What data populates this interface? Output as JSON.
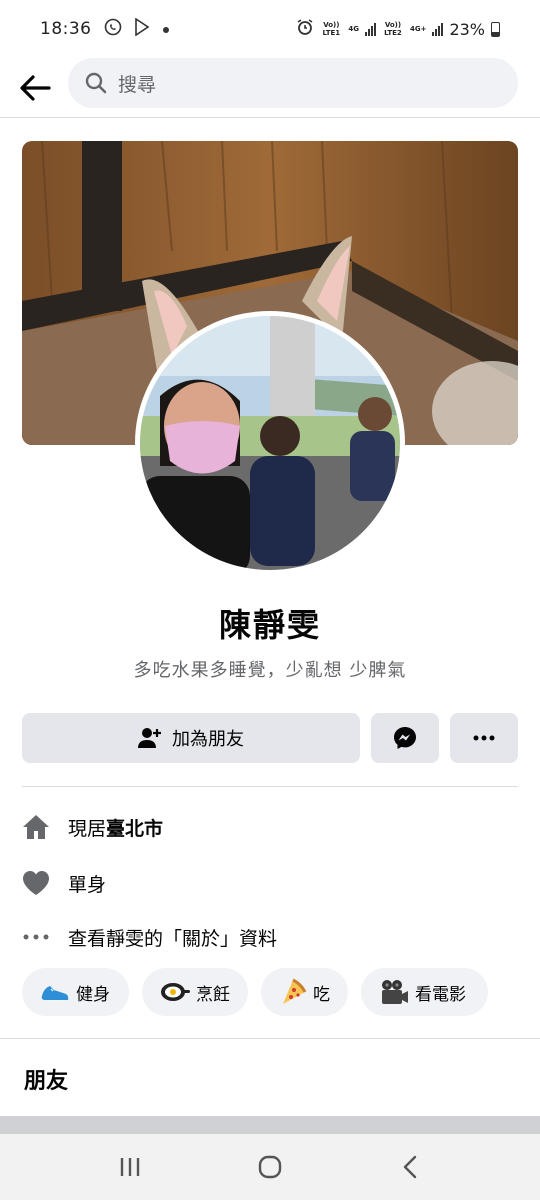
{
  "status_bar": {
    "time": "18:36",
    "sim1_label": "Vo)) LTE1",
    "sim1_net": "4G",
    "sim2_label": "Vo)) LTE2",
    "sim2_net": "4G+",
    "battery": "23%",
    "icons": [
      "whatsapp-icon",
      "play-store-icon",
      "dot-icon",
      "alarm-icon",
      "signal-icon",
      "battery-icon"
    ]
  },
  "search": {
    "placeholder": "搜尋"
  },
  "profile": {
    "name": "陳靜雯",
    "bio": "多吃水果多睡覺，少亂想 少脾氣"
  },
  "actions": {
    "add_friend_label": "加為朋友"
  },
  "intro": {
    "location_prefix": "現居",
    "location_city": "臺北市",
    "relationship": "單身",
    "about_link": "查看靜雯的「關於」資料"
  },
  "hobbies": [
    {
      "label": "健身",
      "icon": "sneaker-icon"
    },
    {
      "label": "烹飪",
      "icon": "frying-pan-icon"
    },
    {
      "label": "吃",
      "icon": "pizza-icon"
    },
    {
      "label": "看電影",
      "icon": "movie-camera-icon"
    }
  ],
  "friends": {
    "title": "朋友"
  },
  "colors": {
    "accent": "#1877f2",
    "button_gray": "#e4e6eb",
    "text_secondary": "#65676b",
    "messenger": "#050505"
  }
}
